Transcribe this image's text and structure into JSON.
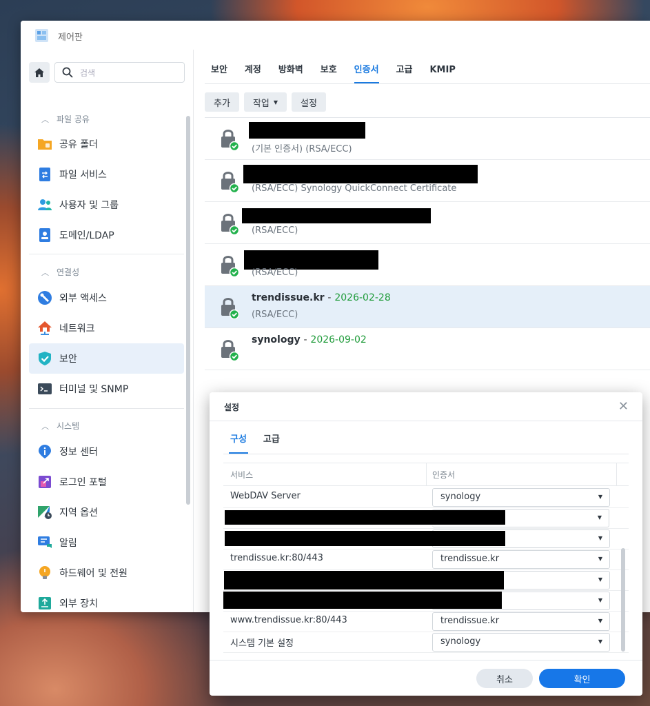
{
  "window": {
    "title": "제어판",
    "icon": "control-panel-icon"
  },
  "sidebar": {
    "search_placeholder": "검색",
    "sections": [
      {
        "label": "파일 공유",
        "items": [
          {
            "label": "공유 폴더",
            "icon": "shared-folder-icon",
            "color": "#f5a623"
          },
          {
            "label": "파일 서비스",
            "icon": "file-services-icon",
            "color": "#2f7de1"
          },
          {
            "label": "사용자 및 그룹",
            "icon": "users-groups-icon",
            "color": "#2f9be1"
          },
          {
            "label": "도메인/LDAP",
            "icon": "domain-ldap-icon",
            "color": "#2f7de1"
          }
        ]
      },
      {
        "label": "연결성",
        "items": [
          {
            "label": "외부 액세스",
            "icon": "external-access-icon",
            "color": "#2f7de1"
          },
          {
            "label": "네트워크",
            "icon": "network-icon",
            "color": "#e4572e"
          },
          {
            "label": "보안",
            "icon": "security-shield-icon",
            "color": "#22b3c4",
            "active": true
          },
          {
            "label": "터미널 및 SNMP",
            "icon": "terminal-icon",
            "color": "#3b4a5a"
          }
        ]
      },
      {
        "label": "시스템",
        "items": [
          {
            "label": "정보 센터",
            "icon": "info-center-icon",
            "color": "#2f7de1"
          },
          {
            "label": "로그인 포털",
            "icon": "login-portal-icon",
            "color": "#7b4bd1"
          },
          {
            "label": "지역 옵션",
            "icon": "regional-options-icon",
            "color": "#2fa36b"
          },
          {
            "label": "알림",
            "icon": "notification-icon",
            "color": "#2f7de1"
          },
          {
            "label": "하드웨어 및 전원",
            "icon": "hardware-power-icon",
            "color": "#f5a623"
          },
          {
            "label": "외부 장치",
            "icon": "external-devices-icon",
            "color": "#1fa99b"
          }
        ]
      }
    ]
  },
  "content": {
    "tabs": [
      "보안",
      "계정",
      "방화벽",
      "보호",
      "인증서",
      "고급",
      "KMIP"
    ],
    "active_tab": "인증서",
    "toolbar": {
      "add": "추가",
      "action": "작업",
      "settings": "설정"
    },
    "certificates": [
      {
        "name": "",
        "date": "",
        "detail": "(기본 인증서) (RSA/ECC)",
        "redacted": true
      },
      {
        "name": "",
        "date": "",
        "detail": "(RSA/ECC) Synology QuickConnect Certificate",
        "redacted": true
      },
      {
        "name": "",
        "date": "",
        "detail": "(RSA/ECC)",
        "redacted": true
      },
      {
        "name": "",
        "date": "",
        "detail": "(RSA/ECC)",
        "redacted": true
      },
      {
        "name": "trendissue.kr",
        "date": "2026-02-28",
        "detail": "(RSA/ECC)",
        "selected": true
      },
      {
        "name": "synology",
        "date": "2026-09-02",
        "detail": ""
      }
    ]
  },
  "dialog": {
    "title": "설정",
    "tabs": [
      "구성",
      "고급"
    ],
    "active_tab": "구성",
    "columns": {
      "service": "서비스",
      "certificate": "인증서"
    },
    "rows": [
      {
        "service": "WebDAV Server",
        "cert": "synology"
      },
      {
        "service": "",
        "cert": "",
        "redacted": true
      },
      {
        "service": "",
        "cert": "",
        "redacted": true
      },
      {
        "service": "trendissue.kr:80/443",
        "cert": "trendissue.kr"
      },
      {
        "service": "",
        "cert": "",
        "redacted": true
      },
      {
        "service": "",
        "cert": "",
        "redacted": true
      },
      {
        "service": "www.trendissue.kr:80/443",
        "cert": "trendissue.kr"
      },
      {
        "service": "시스템 기본 설정",
        "cert": "synology"
      }
    ],
    "cancel": "취소",
    "ok": "확인"
  },
  "colors": {
    "accent": "#1a7ae0",
    "date_green": "#1f9b3a",
    "ok_button": "#1777e8"
  }
}
